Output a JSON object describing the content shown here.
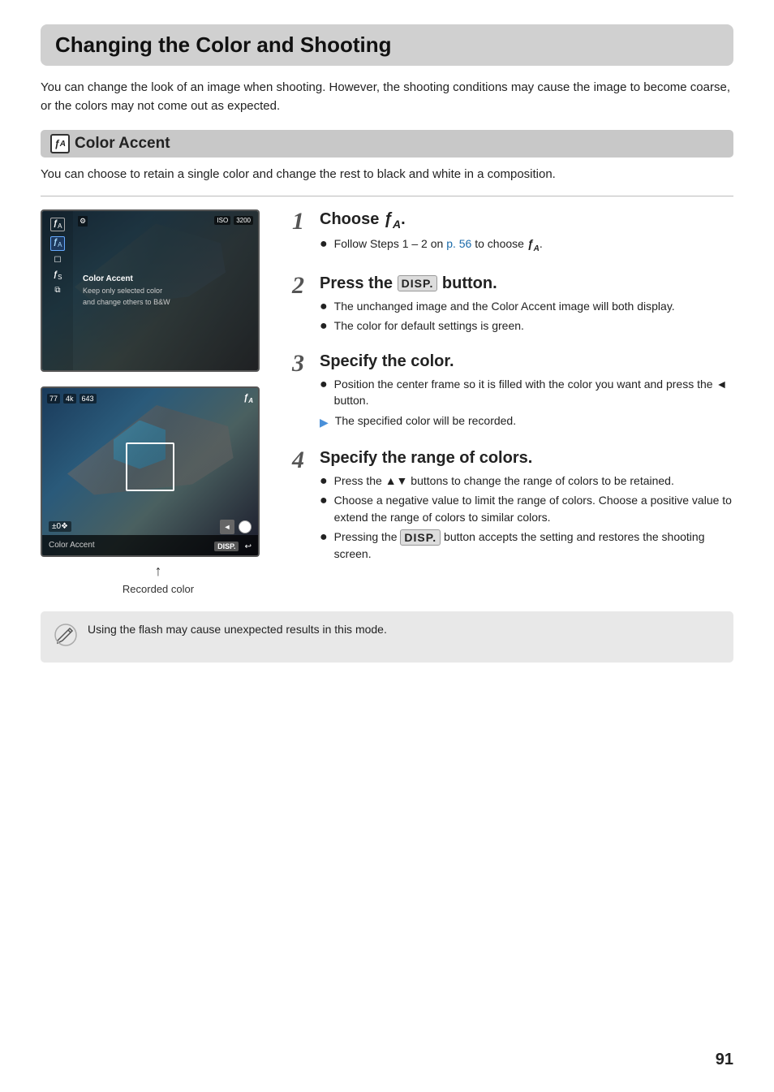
{
  "page": {
    "title": "Changing the Color and Shooting",
    "intro": "You can change the look of an image when shooting. However, the shooting conditions may cause the image to become coarse, or the colors may not come out as expected.",
    "page_number": "91"
  },
  "section": {
    "icon_label": "ƒA",
    "title": "Color Accent",
    "description": "You can choose to retain a single color and change the rest to black and white in a composition."
  },
  "steps": [
    {
      "number": "1",
      "title_prefix": "Choose ",
      "title_icon": "ƒA",
      "title_suffix": ".",
      "bullets": [
        {
          "type": "dot",
          "text_parts": [
            {
              "text": "Follow Steps 1 – 2 on "
            },
            {
              "text": "p. 56",
              "link": true
            },
            {
              "text": " to choose "
            },
            {
              "text": "ƒA",
              "icon": true
            },
            {
              "text": "."
            }
          ]
        }
      ]
    },
    {
      "number": "2",
      "title_prefix": "Press the ",
      "title_disp": "DISP.",
      "title_suffix": " button.",
      "bullets": [
        {
          "type": "dot",
          "text": "The unchanged image and the Color Accent image will both display."
        },
        {
          "type": "dot",
          "text": "The color for default settings is green."
        }
      ]
    },
    {
      "number": "3",
      "title": "Specify the color.",
      "bullets": [
        {
          "type": "dot",
          "text": "Position the center frame so it is filled with the color you want and press the ◄ button."
        },
        {
          "type": "arrow",
          "text": "The specified color will be recorded."
        }
      ]
    },
    {
      "number": "4",
      "title": "Specify the range of colors.",
      "bullets": [
        {
          "type": "dot",
          "text": "Press the ▲▼ buttons to change the range of colors to be retained."
        },
        {
          "type": "dot",
          "text": "Choose a negative value to limit the range of colors. Choose a positive value to extend the range of colors to similar colors."
        },
        {
          "type": "dot",
          "text_parts": [
            {
              "text": "Pressing the "
            },
            {
              "text": "DISP.",
              "disp": true
            },
            {
              "text": " button accepts the setting and restores the shooting screen."
            }
          ]
        }
      ]
    }
  ],
  "note": {
    "text": "Using the flash may cause unexpected results in this mode."
  },
  "recorded_color_label": "Recorded color",
  "camera_screen1": {
    "top_icons": [
      "ƒA",
      "ƒS"
    ],
    "menu_title": "Color Accent",
    "menu_desc1": "Keep only selected color",
    "menu_desc2": "and change others to B&W"
  },
  "camera_screen2": {
    "top_left": [
      "77",
      "4k",
      "643"
    ],
    "mode_icon": "ƒA",
    "label": "Color Accent",
    "disp_label": "DISP.",
    "offset_label": "±0❖"
  }
}
